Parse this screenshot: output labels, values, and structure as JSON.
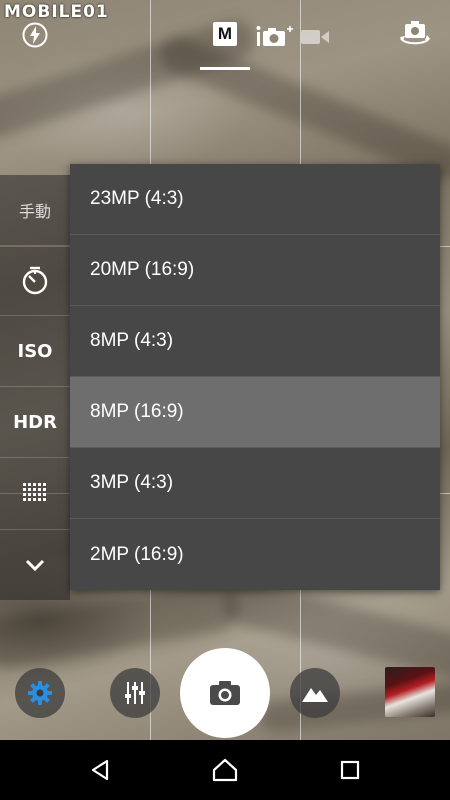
{
  "watermark": "MOBILE01",
  "topbar": {
    "mode_manual_label": "M",
    "icons": [
      "flash-auto-icon",
      "manual-mode-icon",
      "superior-auto-icon",
      "video-mode-icon",
      "switch-camera-icon"
    ]
  },
  "side_panel": {
    "mode_label": "手動",
    "iso_label": "ISO",
    "hdr_label": "HDR",
    "icons": [
      "self-timer-icon",
      "grid-icon",
      "chevron-down-icon"
    ]
  },
  "resolution_menu": {
    "options": [
      "23MP (4:3)",
      "20MP (16:9)",
      "8MP (4:3)",
      "8MP (16:9)",
      "3MP (4:3)",
      "2MP (16:9)"
    ],
    "selected": "8MP (16:9)"
  },
  "bottom_controls": {
    "icons": [
      "settings-gear-icon",
      "adjust-sliders-icon",
      "shutter-camera-icon",
      "scenery-mountain-icon",
      "gallery-thumbnail"
    ]
  },
  "navbar": {
    "icons": [
      "back-icon",
      "home-icon",
      "recents-icon"
    ]
  },
  "colors": {
    "accent": "#2b8fe0",
    "menu_bg": "#474747",
    "menu_selected": "#6e6e6e"
  }
}
